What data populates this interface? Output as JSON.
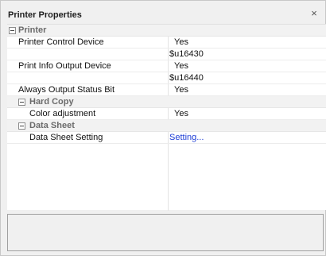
{
  "window": {
    "title": "Printer Properties",
    "close_glyph": "×"
  },
  "categories": {
    "printer": "Printer",
    "hard_copy": "Hard Copy",
    "data_sheet": "Data Sheet"
  },
  "properties": [
    {
      "name": "Printer Control Device",
      "value": "Yes"
    },
    {
      "name": "",
      "value": "$u16430"
    },
    {
      "name": "Print Info Output Device",
      "value": "Yes"
    },
    {
      "name": "",
      "value": "$u16440"
    },
    {
      "name": "Always Output Status Bit",
      "value": "Yes"
    },
    {
      "name": "Color adjustment",
      "value": "Yes"
    },
    {
      "name": "Data Sheet Setting",
      "value": "Setting..."
    }
  ],
  "description": ""
}
